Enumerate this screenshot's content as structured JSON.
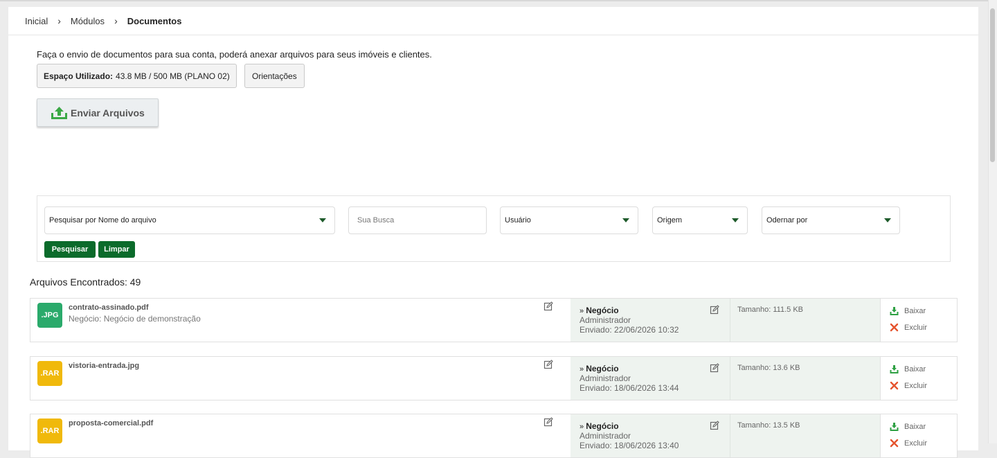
{
  "breadcrumb": [
    "Inicial",
    "Módulos",
    "Documentos"
  ],
  "intro_text": "Faça o envio de documentos para sua conta, poderá anexar arquivos para seus imóveis e clientes.",
  "usage": {
    "label": "Espaço Utilizado:",
    "value": "43.8 MB / 500 MB (PLANO 02)"
  },
  "orientacoes_label": "Orientações",
  "send_label": "Enviar Arquivos",
  "filters": {
    "search_by": "Pesquisar por Nome do arquivo",
    "search_placeholder": "Sua Busca",
    "user": "Usuário",
    "origin": "Origem",
    "order": "Odernar por",
    "search_button": "Pesquisar",
    "clear_button": "Limpar"
  },
  "results_label": "Arquivos Encontrados: 49",
  "files": [
    {
      "badge": ".JPG",
      "badge_color": "#2aaa6b",
      "name": "contrato-assinado.pdf",
      "sub": "Negócio: Negócio de demonstração",
      "type_prefix": "» ",
      "type": "Negócio",
      "user": "Administrador",
      "sent": "Enviado: 22/06/2026 10:32",
      "size": "Tamanho: 111.5 KB",
      "download": "Baixar",
      "delete": "Excluir"
    },
    {
      "badge": ".RAR",
      "badge_color": "#f0b90b",
      "name": "vistoria-entrada.jpg",
      "sub": "",
      "type_prefix": "» ",
      "type": "Negócio",
      "user": "Administrador",
      "sent": "Enviado: 18/06/2026 13:44",
      "size": "Tamanho: 13.6 KB",
      "download": "Baixar",
      "delete": "Excluir"
    },
    {
      "badge": ".RAR",
      "badge_color": "#f0b90b",
      "name": "proposta-comercial.pdf",
      "sub": "",
      "type_prefix": "» ",
      "type": "Negócio",
      "user": "Administrador",
      "sent": "Enviado: 18/06/2026 13:40",
      "size": "Tamanho: 13.5 KB",
      "download": "Baixar",
      "delete": "Excluir"
    }
  ]
}
